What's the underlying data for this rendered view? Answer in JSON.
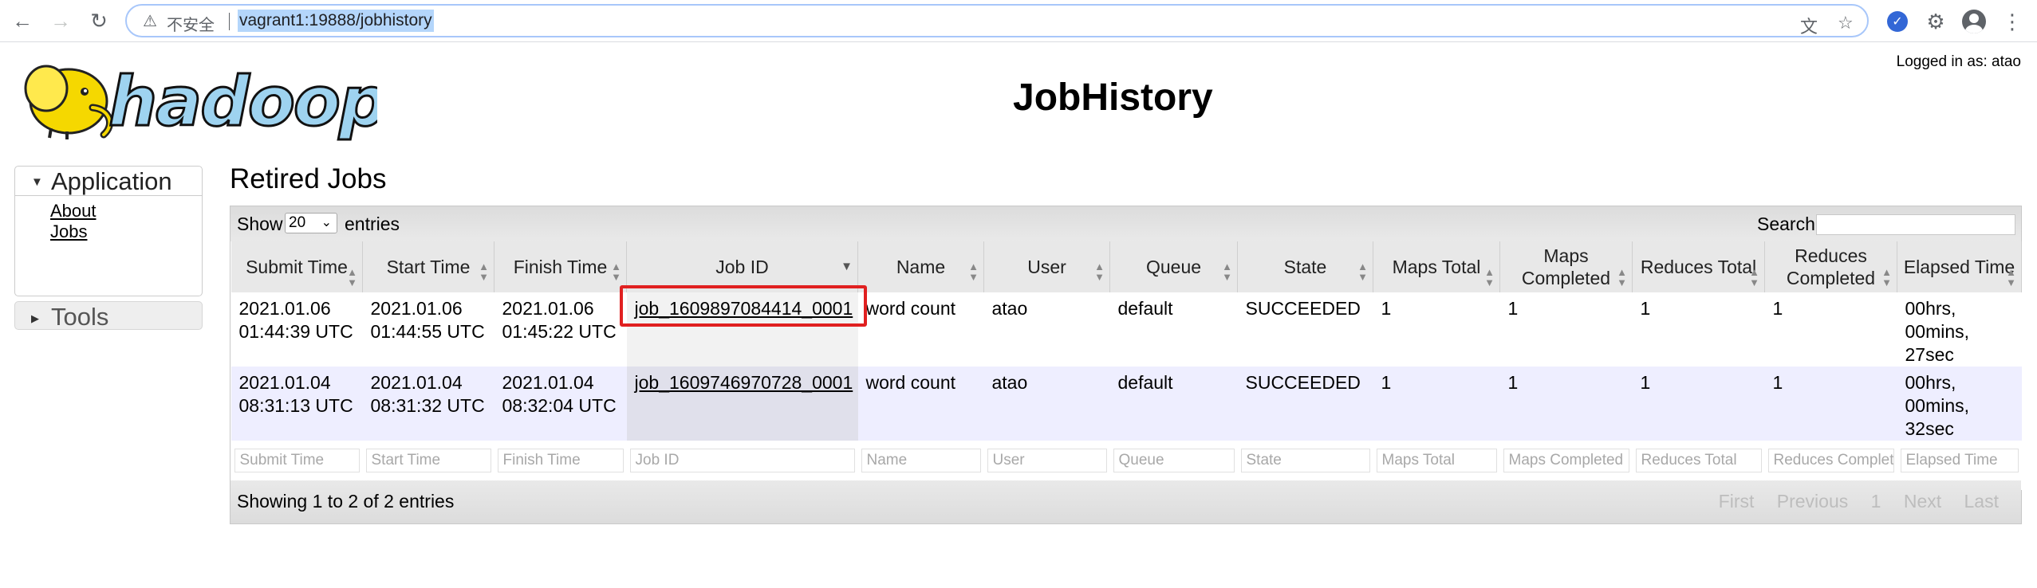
{
  "browser": {
    "security_label": "不安全",
    "url": "vagrant1:19888/jobhistory"
  },
  "header": {
    "logged_in": "Logged in as: atao",
    "title": "JobHistory"
  },
  "nav": {
    "application": {
      "label": "Application",
      "links": [
        "About",
        "Jobs"
      ]
    },
    "tools": {
      "label": "Tools"
    }
  },
  "retired": {
    "title": "Retired Jobs",
    "show_label": "Show",
    "page_length": "20",
    "entries_label": "entries",
    "search_label": "Search:",
    "columns": [
      "Submit Time",
      "Start Time",
      "Finish Time",
      "Job ID",
      "Name",
      "User",
      "Queue",
      "State",
      "Maps Total",
      "Maps Completed",
      "Reduces Total",
      "Reduces Completed",
      "Elapsed Time"
    ],
    "rows": [
      {
        "submit_time": "2021.01.06 01:44:39 UTC",
        "start_time": "2021.01.06 01:44:55 UTC",
        "finish_time": "2021.01.06 01:45:22 UTC",
        "job_id": "job_1609897084414_0001",
        "name": "word count",
        "user": "atao",
        "queue": "default",
        "state": "SUCCEEDED",
        "maps_total": "1",
        "maps_completed": "1",
        "reduces_total": "1",
        "reduces_completed": "1",
        "elapsed_time": "00hrs, 00mins, 27sec"
      },
      {
        "submit_time": "2021.01.04 08:31:13 UTC",
        "start_time": "2021.01.04 08:31:32 UTC",
        "finish_time": "2021.01.04 08:32:04 UTC",
        "job_id": "job_1609746970728_0001",
        "name": "word count",
        "user": "atao",
        "queue": "default",
        "state": "SUCCEEDED",
        "maps_total": "1",
        "maps_completed": "1",
        "reduces_total": "1",
        "reduces_completed": "1",
        "elapsed_time": "00hrs, 00mins, 32sec"
      }
    ],
    "filters": [
      "Submit Time",
      "Start Time",
      "Finish Time",
      "Job ID",
      "Name",
      "User",
      "Queue",
      "State",
      "Maps Total",
      "Maps Completed",
      "Reduces Total",
      "Reduces Completed",
      "Elapsed Time"
    ],
    "info": "Showing 1 to 2 of 2 entries",
    "pager": {
      "first": "First",
      "previous": "Previous",
      "page": "1",
      "next": "Next",
      "last": "Last"
    }
  },
  "colors": {
    "highlight_box": "#e02020",
    "even_row": "#eeeeff",
    "header_bg": "#e8e8e8"
  }
}
